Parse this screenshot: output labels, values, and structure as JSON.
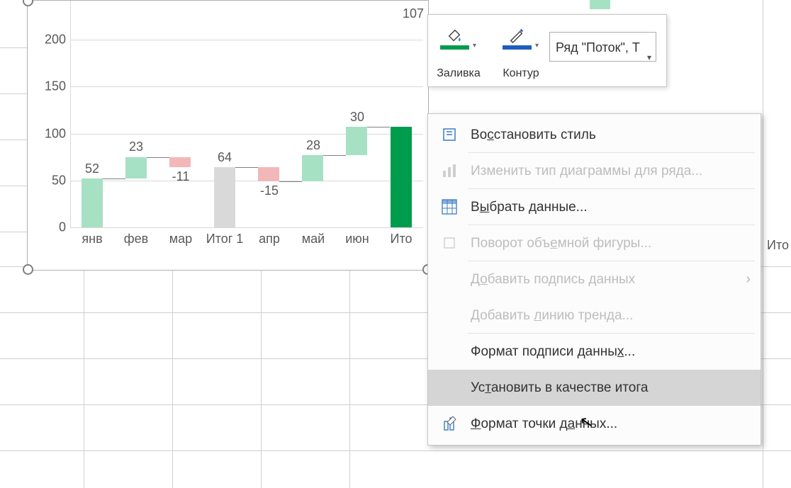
{
  "chart_data": {
    "type": "waterfall",
    "categories": [
      "янв",
      "фев",
      "мар",
      "Итог 1",
      "апр",
      "май",
      "июн",
      "Ито"
    ],
    "values": [
      52,
      23,
      -11,
      64,
      -15,
      28,
      30,
      107
    ],
    "ylim": [
      0,
      200
    ],
    "yticks": [
      0,
      50,
      100,
      150,
      200
    ],
    "colors": {
      "increase": "#a6e1c4",
      "decrease": "#f2b8b8",
      "total": "#d9d9d9",
      "selected_total": "#009c4e"
    }
  },
  "ylabels": {
    "0": "0",
    "50": "50",
    "100": "100",
    "150": "150",
    "200": "200"
  },
  "xlabels": {
    "0": "янв",
    "1": "фев",
    "2": "мар",
    "3": "Итог 1",
    "4": "апр",
    "5": "май",
    "6": "июн",
    "7": "Ито"
  },
  "bar_labels": {
    "0": "52",
    "1": "23",
    "2": "-11",
    "3": "64",
    "4": "-15",
    "5": "28",
    "6": "30",
    "7": "107"
  },
  "right_xcat": "Ито",
  "toolbar": {
    "fill_label": "Заливка",
    "outline_label": "Контур",
    "series_selected": "Ряд \"Поток\",  Т"
  },
  "context_menu": {
    "restore_style": "Восстановить стиль",
    "change_chart_type": "Изменить тип диаграммы для ряда...",
    "select_data": "Выбрать данные...",
    "rotate_3d": "Поворот объемной фигуры...",
    "add_data_label": "Добавить подпись данных",
    "add_trendline": "Добавить линию тренда...",
    "format_data_label": "Формат подписи данных...",
    "set_as_total": "Установить в качестве итога",
    "format_data_point": "Формат точки данных..."
  },
  "underline_chars": {
    "restore": "с",
    "select": "ы",
    "rotate": "е",
    "addlbl": "о",
    "trend": "л",
    "fmtlbl": "х",
    "settotal": "т",
    "fmtpoint": "Ф",
    "fmtpoint2": "а"
  }
}
